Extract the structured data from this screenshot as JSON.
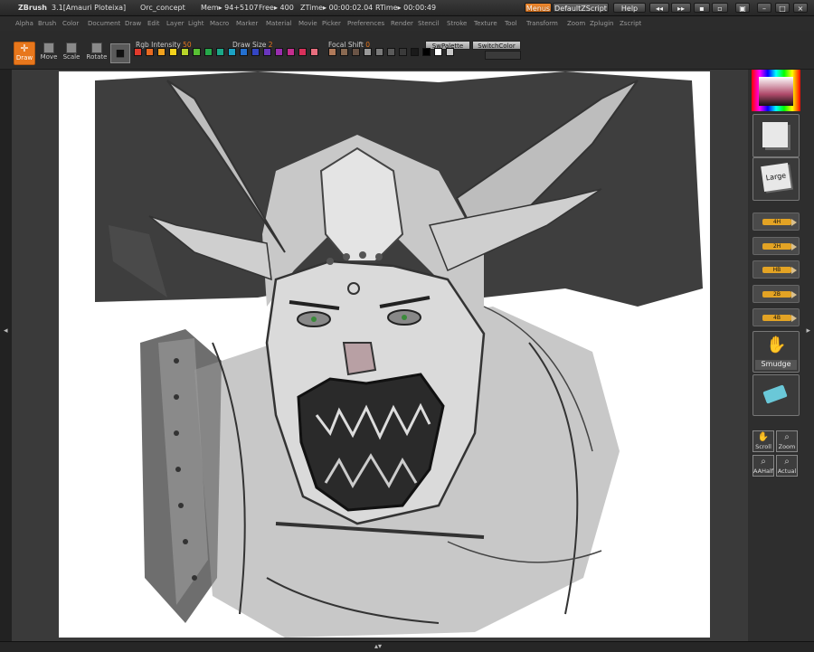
{
  "titlebar": {
    "app": "ZBrush",
    "version": "3.1[Amauri Ploteixa]",
    "document": "Orc_concept",
    "mem": "Mem▸ 94+5107",
    "free": "Free▸ 400",
    "ztime": "ZTime▸ 00:00:02.04",
    "rtime": "RTime▸ 00:00:49",
    "menus_button": "Menus",
    "script_button": "DefaultZScript",
    "help_button": "Help"
  },
  "menubar": {
    "items": [
      "Alpha",
      "Brush",
      "Color",
      "Document",
      "Draw",
      "Edit",
      "Layer",
      "Light",
      "Macro",
      "Marker",
      "Material",
      "Movie",
      "Picker",
      "Preferences",
      "Render",
      "Stencil",
      "Stroke",
      "Texture",
      "Tool",
      "Transform",
      "Zoom",
      "Zplugin",
      "Zscript"
    ]
  },
  "toolbar": {
    "draw_label": "Draw",
    "move_label": "Move",
    "scale_label": "Scale",
    "rotate_label": "Rotate",
    "rgb_label": "Rgb Intensity",
    "rgb_value": "50",
    "drawsize_label": "Draw Size",
    "drawsize_value": "2",
    "focal_label": "Focal Shift",
    "focal_value": "0",
    "swpalette_label": "SwPalette",
    "switchcolor_label": "SwitchColor"
  },
  "palette": [
    "#e23a2c",
    "#e86a22",
    "#f0a21e",
    "#f3d21c",
    "#b8d42a",
    "#58c034",
    "#26a84a",
    "#1ca888",
    "#1ca2c4",
    "#2470d0",
    "#3446c4",
    "#6a36be",
    "#9a2eb0",
    "#c42e8e",
    "#d8305a",
    "#e86e7e",
    "#b07a5a",
    "#8a6a52",
    "#6a5446",
    "#9a9a9a",
    "#7a7a7a",
    "#5a5a5a",
    "#3a3a3a",
    "#1a1a1a",
    "#000000",
    "#ffffff",
    "#c8c8c8"
  ],
  "rightpanel": {
    "large_label": "Large",
    "pencils": [
      "4H",
      "2H",
      "HB",
      "2B",
      "4B"
    ],
    "smudge_label": "Smudge",
    "nav": [
      "Scroll",
      "Zoom",
      "AAHalf",
      "Actual"
    ]
  },
  "colors": {
    "accent": "#e8771c",
    "background": "#2a2a2a",
    "canvas": "#ffffff"
  }
}
